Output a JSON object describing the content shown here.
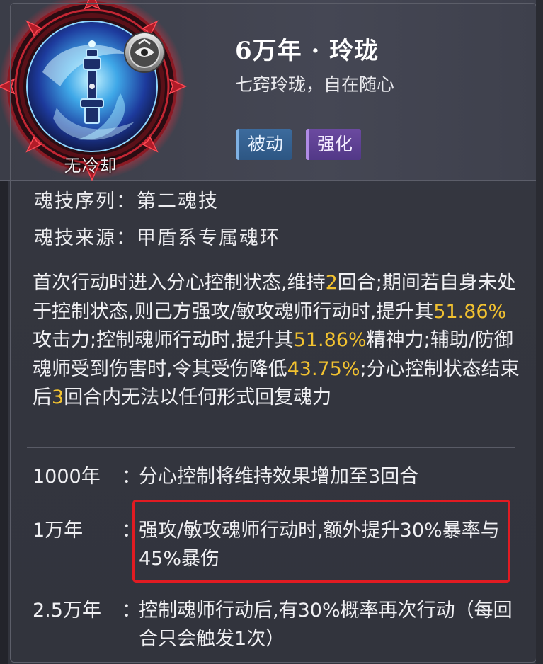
{
  "skill": {
    "cooldown_label": "无冷却",
    "title": "6万年 · 玲珑",
    "subtitle": "七窍玲珑，自在随心",
    "tags": [
      "被动",
      "强化"
    ],
    "icon": "spirit-skill-emblem-icon"
  },
  "info": {
    "order_label": "魂技序列：",
    "order_value": "第二魂技",
    "source_label": "魂技来源：",
    "source_value": "甲盾系专属魂环"
  },
  "description": {
    "parts": [
      "首次行动时进入分心控制状态,维持",
      "2",
      "回合;期间若自身未处于控制状态,则己方强攻/敏攻魂师行动时,提升其",
      "51.86%",
      "攻击力;控制魂师行动时,提升其",
      "51.86%",
      "精神力;辅助/防御魂师受到伤害时,令其受伤降低",
      "43.75%",
      ";分心控制状态结束后",
      "3",
      "回合内无法以任何形式回复魂力"
    ]
  },
  "upgrades": [
    {
      "year": "1000年",
      "colon": "：",
      "text": "分心控制将维持效果增加至3回合"
    },
    {
      "year": "1万年",
      "colon": "：",
      "text": "强攻/敏攻魂师行动时,额外提升30%暴率与45%暴伤"
    },
    {
      "year": "2.5万年",
      "colon": "：",
      "text": "控制魂师行动后,有30%概率再次行动（每回合只会触发1次）"
    }
  ],
  "colors": {
    "highlight": "#f2c230",
    "annotation_box": "#e11b22",
    "passive_tag": "#2d5683",
    "enhance_tag": "#523887"
  }
}
